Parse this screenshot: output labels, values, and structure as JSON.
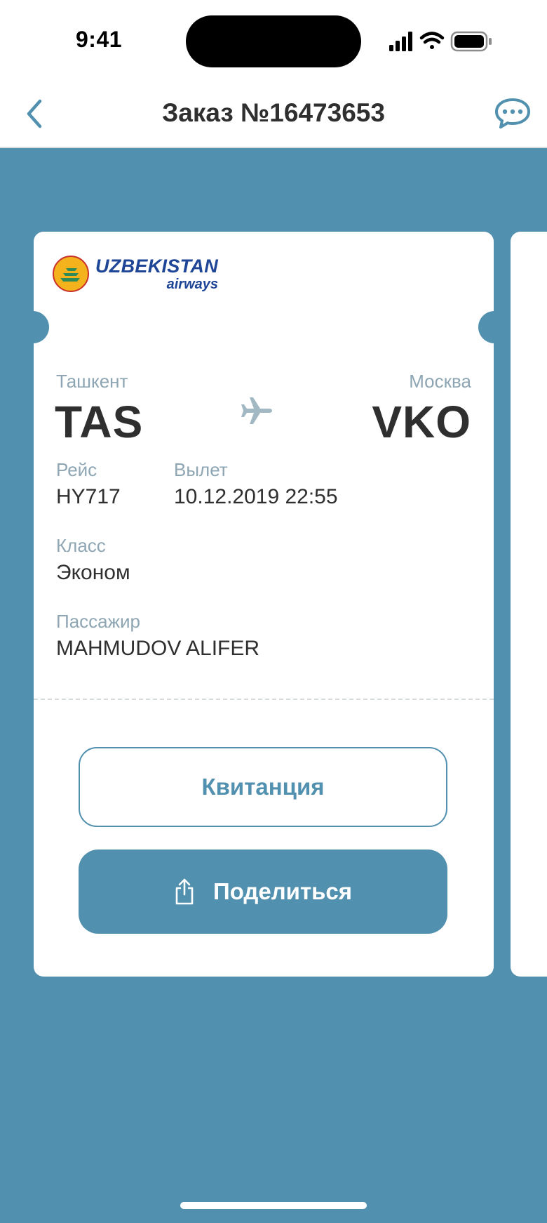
{
  "status_bar": {
    "time": "9:41"
  },
  "nav": {
    "title": "Заказ №16473653",
    "back_icon": "chevron-left-icon",
    "chat_icon": "chat-bubble-icon"
  },
  "colors": {
    "accent": "#5190ae",
    "background": "#5190ae",
    "label": "#8ea6b3",
    "text": "#2f2f2f",
    "airline_blue": "#1f4596",
    "logo_yellow": "#f4b31c"
  },
  "ticket": {
    "airline": {
      "name_line1": "UZBEKISTAN",
      "name_line2": "airways"
    },
    "origin": {
      "city": "Ташкент",
      "code": "TAS"
    },
    "destination": {
      "city": "Москва",
      "code": "VKO"
    },
    "flight": {
      "label": "Рейс",
      "value": "HY717"
    },
    "departure": {
      "label": "Вылет",
      "value": "10.12.2019 22:55"
    },
    "class": {
      "label": "Класс",
      "value": "Эконом"
    },
    "passenger": {
      "label": "Пассажир",
      "value": "MAHMUDOV ALIFER"
    },
    "receipt_button": "Квитанция",
    "share_button": "Поделиться"
  }
}
